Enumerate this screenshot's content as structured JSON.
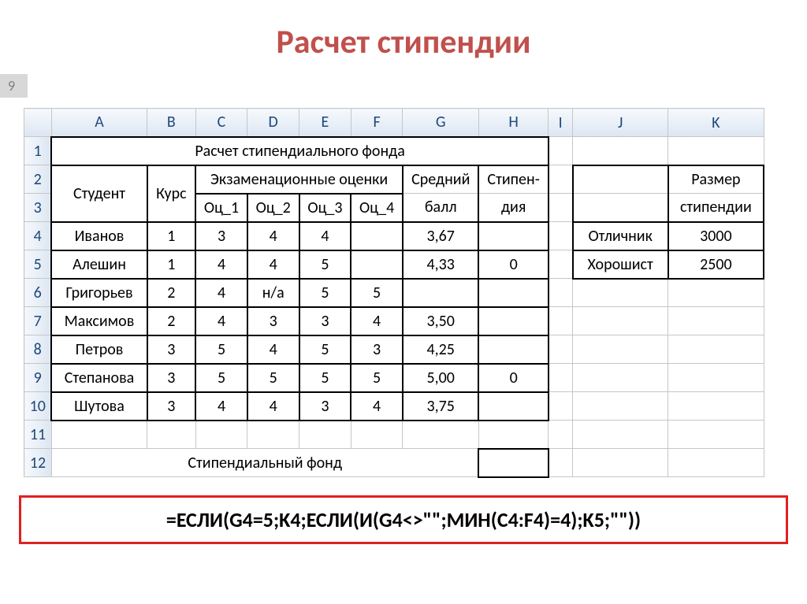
{
  "slide": {
    "title": "Расчет стипендии",
    "page_number": "9"
  },
  "columns": [
    "A",
    "B",
    "C",
    "D",
    "E",
    "F",
    "G",
    "H",
    "I",
    "J",
    "K"
  ],
  "row_numbers": [
    "1",
    "2",
    "3",
    "4",
    "5",
    "6",
    "7",
    "8",
    "9",
    "10",
    "11",
    "12"
  ],
  "table": {
    "title": "Расчет стипендиального фонда",
    "headers": {
      "student": "Студент",
      "course": "Курс",
      "exam_group": "Экзаменационные оценки",
      "g1": "Оц_1",
      "g2": "Оц_2",
      "g3": "Оц_3",
      "g4": "Оц_4",
      "avg": "Средний балл",
      "stip": "Стипен-дия",
      "stip_top": "Стипен-",
      "stip_bot": "дия",
      "avg_top": "Средний",
      "avg_bot": "балл"
    },
    "rows": [
      {
        "name": "Иванов",
        "course": "1",
        "g1": "3",
        "g2": "4",
        "g3": "4",
        "g4": "",
        "avg": "3,67",
        "stip": ""
      },
      {
        "name": "Алешин",
        "course": "1",
        "g1": "4",
        "g2": "4",
        "g3": "5",
        "g4": "",
        "avg": "4,33",
        "stip": "0"
      },
      {
        "name": "Григорьев",
        "course": "2",
        "g1": "4",
        "g2": "н/а",
        "g3": "5",
        "g4": "5",
        "avg": "",
        "stip": ""
      },
      {
        "name": "Максимов",
        "course": "2",
        "g1": "4",
        "g2": "3",
        "g3": "3",
        "g4": "4",
        "avg": "3,50",
        "stip": ""
      },
      {
        "name": "Петров",
        "course": "3",
        "g1": "5",
        "g2": "4",
        "g3": "5",
        "g4": "3",
        "avg": "4,25",
        "stip": ""
      },
      {
        "name": "Степанова",
        "course": "3",
        "g1": "5",
        "g2": "5",
        "g3": "5",
        "g4": "5",
        "avg": "5,00",
        "stip": "0"
      },
      {
        "name": "Шутова",
        "course": "3",
        "g1": "4",
        "g2": "4",
        "g3": "3",
        "g4": "4",
        "avg": "3,75",
        "stip": ""
      }
    ],
    "footer_label": "Стипендиальный фонд"
  },
  "side_table": {
    "size_header": "Размер стипендии",
    "size_top": "Размер",
    "size_bot": "стипендии",
    "rows": [
      {
        "label": "Отличник",
        "value": "3000"
      },
      {
        "label": "Хорошист",
        "value": "2500"
      }
    ]
  },
  "formula": "=ЕСЛИ(G4=5;K4;ЕСЛИ(И(G4<>\"\";МИН(C4:F4)=4);K5;\"\"))"
}
